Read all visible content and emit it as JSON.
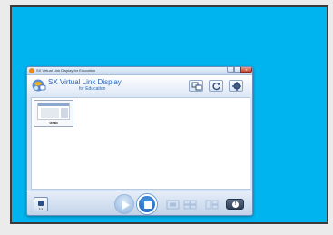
{
  "window": {
    "title": "SX Virtual Link Display for Education",
    "close_glyph": "x"
  },
  "header": {
    "brand_name": "SX Virtual Link Display",
    "brand_sub": "for Education",
    "icons": [
      "display-switch-icon",
      "refresh-icon",
      "settings-gear-icon"
    ]
  },
  "devices": [
    {
      "label": "Grab"
    }
  ],
  "toolbar": {
    "left_caption": "1:1",
    "icons": [
      "play-icon",
      "stop-icon",
      "fullscreen-icon",
      "grid-view-icon",
      "split-view-icon",
      "info-icon"
    ],
    "info_glyph": "!"
  },
  "colors": {
    "desktop": "#00b4ef",
    "brand": "#2a66b5",
    "active_button": "#1b5fb4"
  }
}
